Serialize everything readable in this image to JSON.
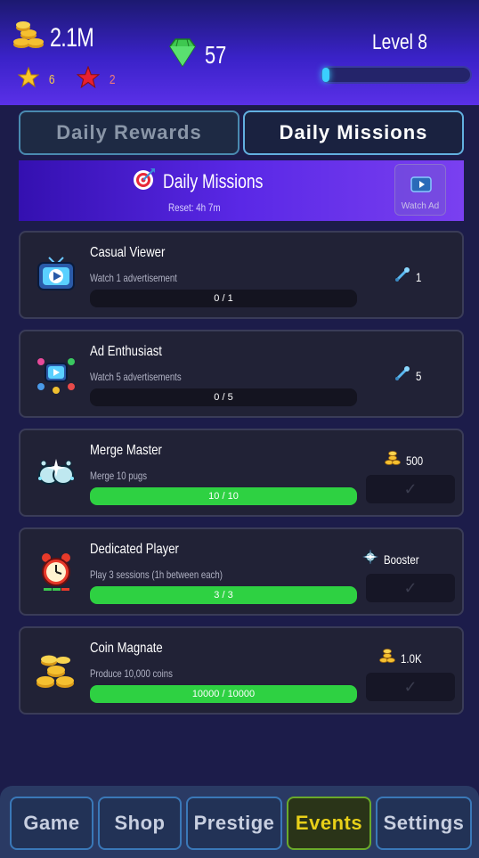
{
  "header": {
    "coins": "2.1M",
    "gold_stars": "6",
    "red_stars": "2",
    "gems": "57",
    "level_label": "Level 8",
    "level_progress": 0.04
  },
  "tabs": [
    {
      "label": "Daily Rewards",
      "active": false
    },
    {
      "label": "Daily Missions",
      "active": true
    }
  ],
  "banner": {
    "title": "Daily Missions",
    "reset": "Reset: 4h 7m",
    "watch_ad_label": "Watch Ad"
  },
  "missions": [
    {
      "name": "Casual Viewer",
      "desc": "Watch 1 advertisement",
      "progress_text": "0 / 1",
      "progress": 0.0,
      "reward": "1",
      "reward_icon": "tool-icon",
      "claimable": false
    },
    {
      "name": "Ad Enthusiast",
      "desc": "Watch 5 advertisements",
      "progress_text": "0 / 5",
      "progress": 0.0,
      "reward": "5",
      "reward_icon": "tool-icon",
      "claimable": false
    },
    {
      "name": "Merge Master",
      "desc": "Merge 10 pugs",
      "progress_text": "10 / 10",
      "progress": 1.0,
      "reward": "500",
      "reward_icon": "coins-icon",
      "claimable": true
    },
    {
      "name": "Dedicated Player",
      "desc": "Play 3 sessions (1h between each)",
      "progress_text": "3 / 3",
      "progress": 1.0,
      "reward": "Booster",
      "reward_icon": "booster-icon",
      "claimable": true
    },
    {
      "name": "Coin Magnate",
      "desc": "Produce 10,000 coins",
      "progress_text": "10000 / 10000",
      "progress": 1.0,
      "reward": "1.0K",
      "reward_icon": "coins-icon",
      "claimable": true
    }
  ],
  "claim_symbol": "✓",
  "nav": [
    {
      "label": "Game",
      "active": false
    },
    {
      "label": "Shop",
      "active": false
    },
    {
      "label": "Prestige",
      "active": false
    },
    {
      "label": "Events",
      "active": true
    },
    {
      "label": "Settings",
      "active": false
    }
  ],
  "colors": {
    "progress_fill": "#2ed142",
    "active_nav_text": "#e8d018",
    "level_bar_fill": "#3ad0ff"
  }
}
